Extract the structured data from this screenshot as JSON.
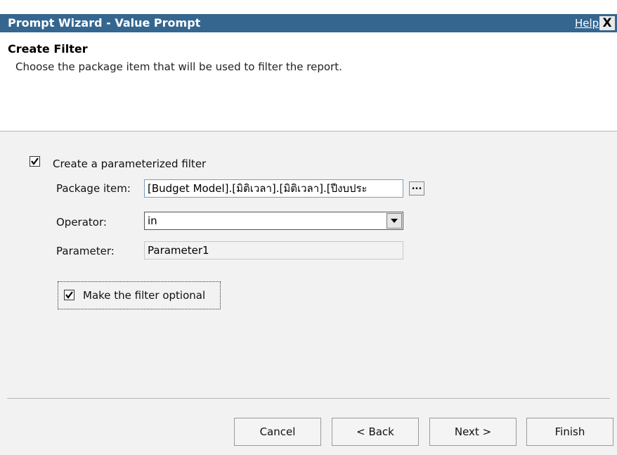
{
  "window": {
    "title": "Prompt Wizard - Value Prompt",
    "help_label": "Help",
    "close_label": "X"
  },
  "header": {
    "heading": "Create Filter",
    "description": "Choose the package item that will be used to filter the report."
  },
  "form": {
    "parameterized": {
      "label": "Create a parameterized filter",
      "checked": true
    },
    "package_item": {
      "label": "Package item:",
      "value": "[Budget Model].[มิติเวลา].[มิติเวลา].[ปีงบประ",
      "browse_label": "..."
    },
    "operator": {
      "label": "Operator:",
      "value": "in"
    },
    "parameter": {
      "label": "Parameter:",
      "value": "Parameter1"
    },
    "optional": {
      "label": "Make the filter optional",
      "checked": true
    }
  },
  "buttons": {
    "cancel": "Cancel",
    "back": "< Back",
    "next": "Next >",
    "finish": "Finish"
  }
}
